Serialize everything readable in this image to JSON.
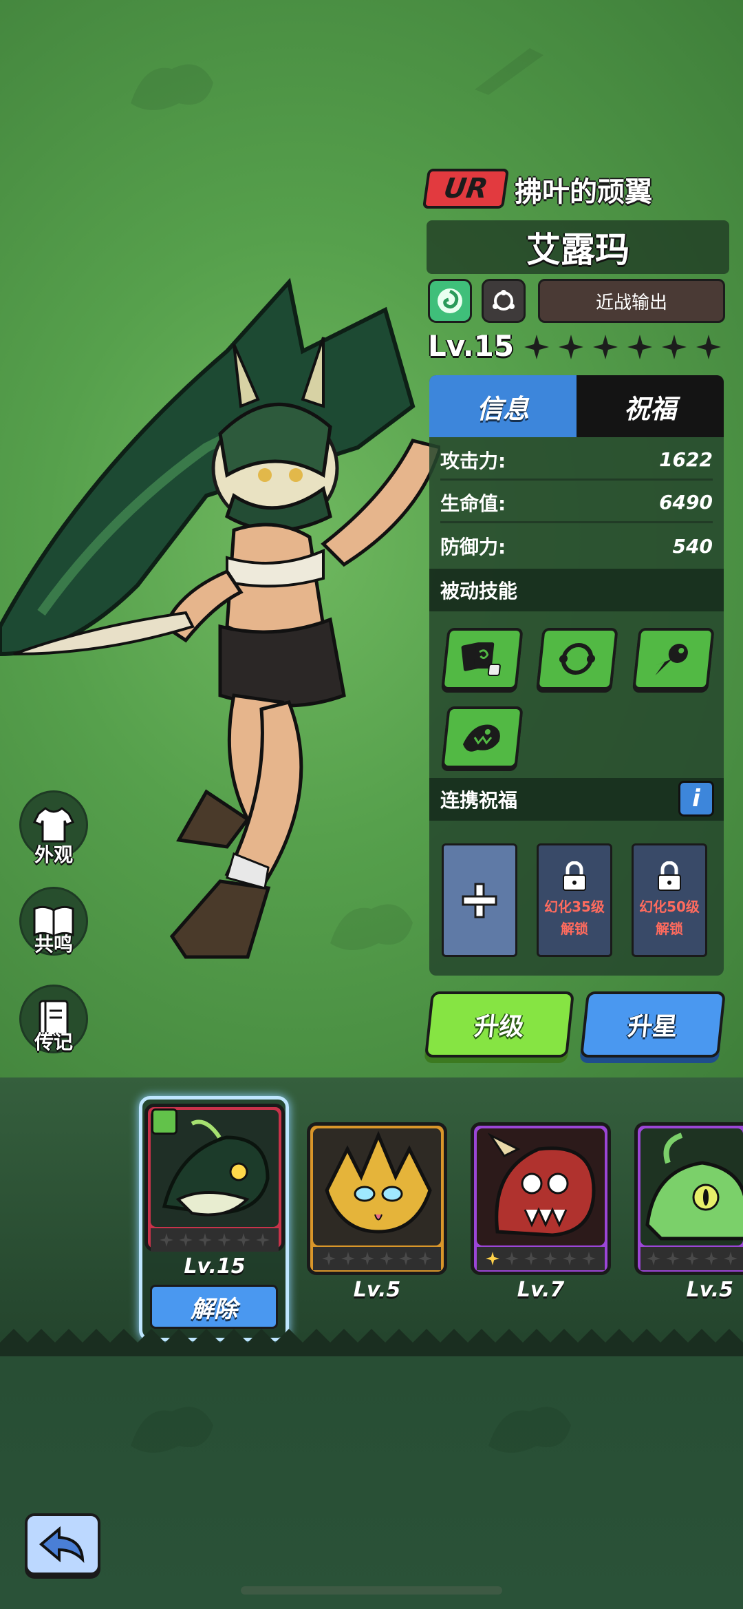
{
  "hero": {
    "rarity": "UR",
    "title": "拂叶的顽翼",
    "name": "艾露玛",
    "role": "近战输出",
    "level": "Lv.15",
    "stars_total": 6,
    "stars_filled": 0
  },
  "tabs": [
    {
      "label": "信息",
      "active": true
    },
    {
      "label": "祝福",
      "active": false
    }
  ],
  "stats": [
    {
      "label": "攻击力:",
      "value": "1622"
    },
    {
      "label": "生命值:",
      "value": "6490"
    },
    {
      "label": "防御力:",
      "value": "540"
    }
  ],
  "passive": {
    "header": "被动技能",
    "skills": [
      "cards-dice-skill-icon",
      "cycle-skill-icon",
      "comet-skill-icon",
      "beast-roar-skill-icon"
    ]
  },
  "link_blessing": {
    "header": "连携祝福",
    "info_label": "i",
    "slots": [
      {
        "type": "add"
      },
      {
        "type": "locked",
        "line1": "幻化35级",
        "line2": "解锁"
      },
      {
        "type": "locked",
        "line1": "幻化50级",
        "line2": "解锁"
      }
    ]
  },
  "actions": {
    "upgrade": "升级",
    "star_up": "升星"
  },
  "side_menu": [
    {
      "label": "外观",
      "icon": "shirt-icon"
    },
    {
      "label": "共鸣",
      "icon": "book-icon"
    },
    {
      "label": "传记",
      "icon": "journal-icon"
    }
  ],
  "pets": [
    {
      "level": "Lv.15",
      "frame": "#c8334a",
      "selected": true,
      "stars": 0
    },
    {
      "level": "Lv.5",
      "frame": "#d9962a",
      "selected": false,
      "stars": 0
    },
    {
      "level": "Lv.7",
      "frame": "#9b46d6",
      "selected": false,
      "stars": 1
    },
    {
      "level": "Lv.5",
      "frame": "#9b46d6",
      "selected": false,
      "stars": 0
    }
  ],
  "remove_label": "解除",
  "colors": {
    "rarity_red": "#e23a3f",
    "tab_blue": "#3d86db",
    "upgrade_green": "#86e443",
    "star_blue": "#4a98f0",
    "lock_text_red": "#ff6b5e"
  }
}
